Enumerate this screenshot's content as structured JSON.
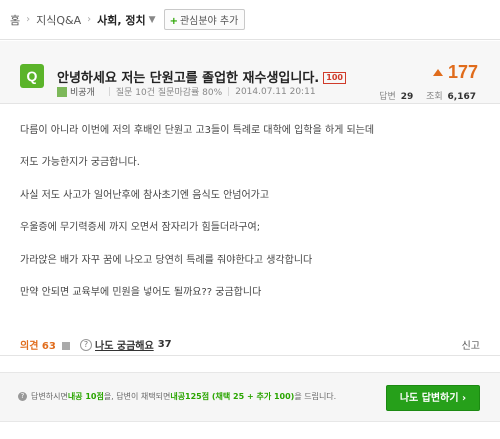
{
  "breadcrumb": {
    "home": "홈",
    "category": "지식Q&A",
    "current": "사회, 정치",
    "add_interest": "관심분야 추가"
  },
  "question": {
    "icon_letter": "Q",
    "title": "안녕하세요 저는 단원고를 졸업한 재수생입니다.",
    "bounty_badge": "100",
    "author": "비공개",
    "asker_info": "질문 10건 질문마감률 80%",
    "date": "2014.07.11 20:11",
    "score": "177",
    "answers_label": "답변",
    "answers_count": "29",
    "views_label": "조회",
    "views_count": "6,167"
  },
  "body": {
    "lines": [
      "다름이 아니라 이번에 저의 후배인 단원고 고3들이 특례로 대학에 입학을 하게 되는데",
      "저도 가능한지가 궁금합니다.",
      "사실 저도 사고가 일어난후에 참사초기엔 음식도 안넘어가고",
      "우울증에 무기력증세 까지 오면서 잠자리가 힘들더라구여;",
      "가라앉은 배가 자꾸 꿈에 나오고 당연히 특례를 줘야한다고 생각합니다",
      "만약 안되면 교육부에 민원을 넣어도 될까요?? 궁금합니다"
    ]
  },
  "actions": {
    "opinion_label": "의견",
    "opinion_count": "63",
    "metoo_label": "나도 궁금해요",
    "metoo_count": "37",
    "report_label": "신고"
  },
  "footer": {
    "text_1": "답변하시면 ",
    "points_1": "내공 10점",
    "text_2": "을, 답변이 채택되면 ",
    "points_2": "내공125점 (채택 25 + 추가 100)",
    "text_3": "을 드립니다.",
    "answer_button": "나도 답변하기 ›"
  },
  "colors": {
    "accent_green": "#26a01a",
    "score_orange": "#e06c1c",
    "q_icon_green": "#5bb42a"
  }
}
